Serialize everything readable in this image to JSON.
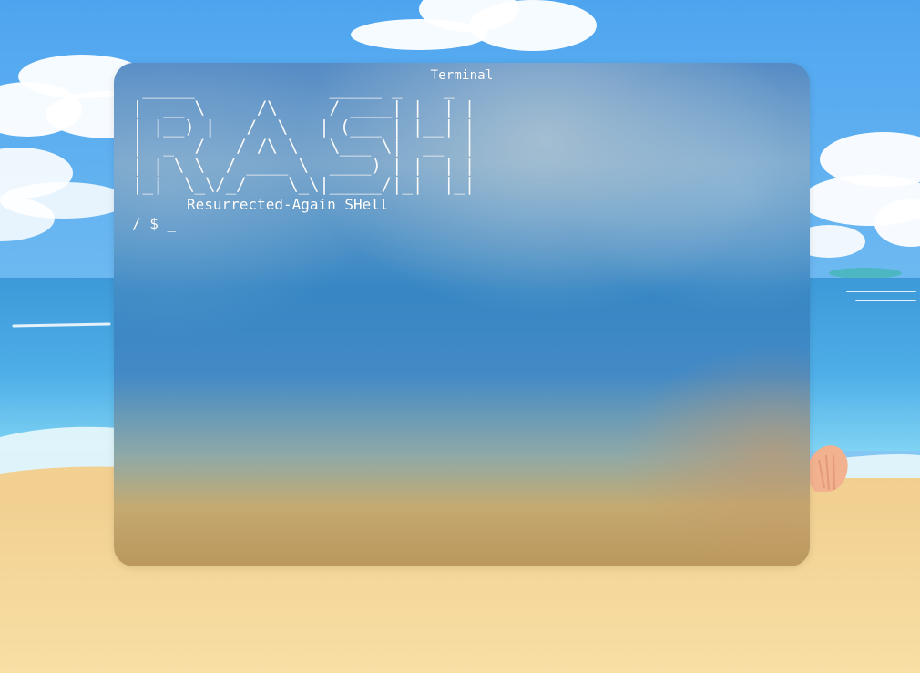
{
  "window": {
    "title": "Terminal"
  },
  "terminal": {
    "ascii_logo": " _____             _____ _    _ \n|  __ \\     /\\     / ____| |  | |\n| |__) |   /  \\   | (___ | |__| |\n|  _  /   / /\\ \\   \\___ \\|  __  |\n| | \\ \\  / ____ \\  ____) | |  | |\n|_|  \\_\\/_/    \\_\\|_____/|_|  |_|",
    "subtitle": "Resurrected-Again SHell",
    "prompt": "/ $ ",
    "cursor": "_"
  },
  "colors": {
    "terminal_text": "#ffffff",
    "sky": "#6fb4ec",
    "sea": "#2f7fc3",
    "sand": "#f5d59a"
  }
}
